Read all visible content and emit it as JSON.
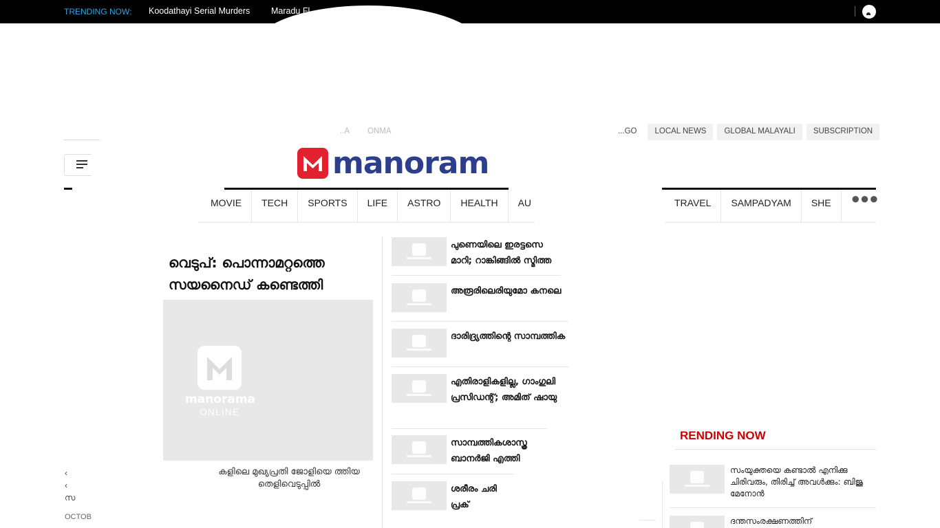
{
  "trending_bar": {
    "label": "TRENDING NOW:",
    "items": [
      "Koodathayi Serial Murders",
      "Maradu Fl"
    ]
  },
  "secondary_links": {
    "left": [
      "..A",
      "ONMA"
    ],
    "right": [
      "...GO",
      "LOCAL NEWS",
      "GLOBAL MALAYALI",
      "SUBSCRIPTION"
    ]
  },
  "brand": {
    "name": "manoram",
    "accent": "#e12030",
    "text_color": "#2c3e8c"
  },
  "nav": {
    "left": [
      "MOVIE",
      "TECH",
      "SPORTS",
      "LIFE",
      "ASTRO",
      "HEALTH",
      "AU"
    ],
    "right": [
      "TRAVEL",
      "SAMPADYAM",
      "SHE"
    ],
    "more_icon": "more-dots-icon"
  },
  "lead": {
    "title": "വെടുപ്: പൊന്നാമറ്റത്തെ സയനൈഡ് കണ്ടെത്തി",
    "image_brand": "manorama",
    "image_sub": "ONLINE",
    "caption": "കളിലെ മുഖ്യപ്രതി ജോളിയെ ത്തിയ തെളിവെടുപ്പിൽ",
    "side_snippets": [
      "‹",
      "‹",
      "സ"
    ],
    "date": "OCTOB"
  },
  "stories": [
    {
      "line1": "പുണെയിലെ ഇരട്ടസെ",
      "line2": "മാറി; റാങ്കിങ്ങിൽ സ്മിത്ത"
    },
    {
      "line1": "അരൂരിലെരിയുമോ കനലെ",
      "line2": ""
    },
    {
      "line1": "ദാരിദ്ര്യത്തിന്റെ സാമ്പത്തിക",
      "line2": ""
    },
    {
      "line1": "എതിരാളികളില്ല, ഗാംഗുലി",
      "line2": "പ്രസിഡന്റ്; അമിത് ഷായു"
    },
    {
      "line1": "സാമ്പത്തികശാസ്ത്ര",
      "line2": "ബാനർജി എത്തി"
    },
    {
      "line1": "ശരീരം ചരി",
      "line2": "പ്രക്"
    }
  ],
  "trending_now": {
    "heading": "RENDING NOW",
    "items": [
      "സംയുക്തയെ കണ്ടാൽ എനിക്കു ചിരിവരും, തിരിച്ച് അവൾക്കും: ബിജു മേനോൻ",
      "ദന്തസംരക്ഷണത്തിന്"
    ]
  }
}
